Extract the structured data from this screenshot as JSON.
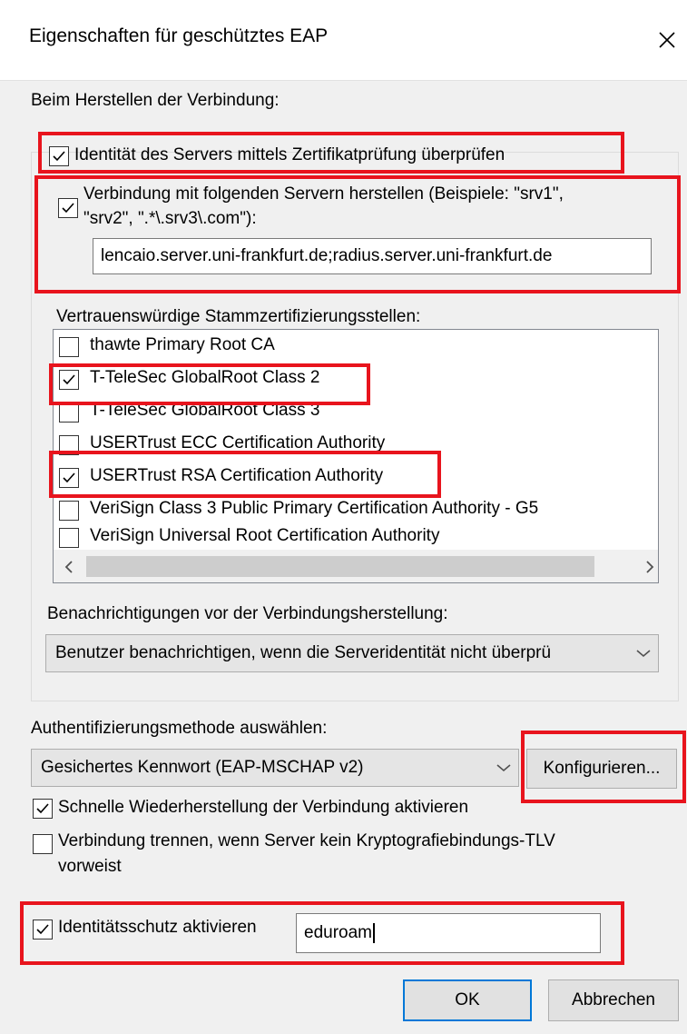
{
  "dialog": {
    "title": "Eigenschaften für geschütztes EAP"
  },
  "connection": {
    "heading": "Beim Herstellen der Verbindung:",
    "verify_server_identity": {
      "label": "Identität des Servers mittels Zertifikatprüfung überprüfen",
      "checked": true
    },
    "connect_to_servers": {
      "label_line1": "Verbindung mit folgenden Servern herstellen (Beispiele: \"srv1\",",
      "label_line2": "\"srv2\", \".*\\.srv3\\.com\"):",
      "checked": true,
      "value": "lencaio.server.uni-frankfurt.de;radius.server.uni-frankfurt.de"
    },
    "root_ca_label": "Vertrauenswürdige Stammzertifizierungsstellen:",
    "root_cas": [
      {
        "name": "thawte Primary Root CA",
        "checked": false
      },
      {
        "name": "T-TeleSec GlobalRoot Class 2",
        "checked": true
      },
      {
        "name": "T-TeleSec GlobalRoot Class 3",
        "checked": false
      },
      {
        "name": "USERTrust ECC Certification Authority",
        "checked": false
      },
      {
        "name": "USERTrust RSA Certification Authority",
        "checked": true
      },
      {
        "name": "VeriSign Class 3 Public Primary Certification Authority - G5",
        "checked": false
      },
      {
        "name": "VeriSign Universal Root Certification Authority",
        "checked": false
      }
    ],
    "notifications_label": "Benachrichtigungen vor der Verbindungsherstellung:",
    "notifications_value": "Benutzer benachrichtigen, wenn die Serveridentität nicht überprü"
  },
  "auth": {
    "label": "Authentifizierungsmethode auswählen:",
    "method_value": "Gesichertes Kennwort (EAP-MSCHAP v2)",
    "configure_label": "Konfigurieren...",
    "fast_reconnect": {
      "label": "Schnelle Wiederherstellung der Verbindung aktivieren",
      "checked": true
    },
    "disconnect_tlv": {
      "label_line1": "Verbindung trennen, wenn Server kein Kryptografiebindungs-TLV",
      "label_line2": "vorweist",
      "checked": false
    },
    "identity_privacy": {
      "label": "Identitätsschutz aktivieren",
      "checked": true,
      "value": "eduroam"
    }
  },
  "buttons": {
    "ok": "OK",
    "cancel": "Abbrechen"
  },
  "colors": {
    "highlight": "#e8141d",
    "dialog_bg": "#f0f0f0",
    "accent": "#0078d7"
  }
}
